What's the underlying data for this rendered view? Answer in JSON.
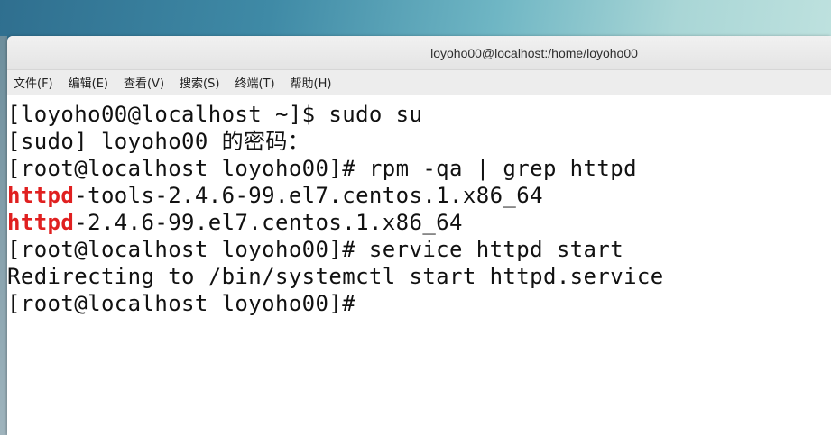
{
  "window": {
    "title": "loyoho00@localhost:/home/loyoho00"
  },
  "menu": {
    "items": [
      {
        "label": "文件(F)"
      },
      {
        "label": "编辑(E)"
      },
      {
        "label": "查看(V)"
      },
      {
        "label": "搜索(S)"
      },
      {
        "label": "终端(T)"
      },
      {
        "label": "帮助(H)"
      }
    ]
  },
  "terminal": {
    "lines": [
      {
        "text": "[loyoho00@localhost ~]$ sudo su"
      },
      {
        "text": "[sudo] loyoho00 的密码："
      },
      {
        "text": "[root@localhost loyoho00]# rpm -qa | grep httpd"
      },
      {
        "highlight": "httpd",
        "text": "-tools-2.4.6-99.el7.centos.1.x86_64"
      },
      {
        "highlight": "httpd",
        "text": "-2.4.6-99.el7.centos.1.x86_64"
      },
      {
        "text": "[root@localhost loyoho00]# service httpd start"
      },
      {
        "text": "Redirecting to /bin/systemctl start httpd.service"
      },
      {
        "text": "[root@localhost loyoho00]# "
      }
    ],
    "highlight_color": "#e02020"
  }
}
